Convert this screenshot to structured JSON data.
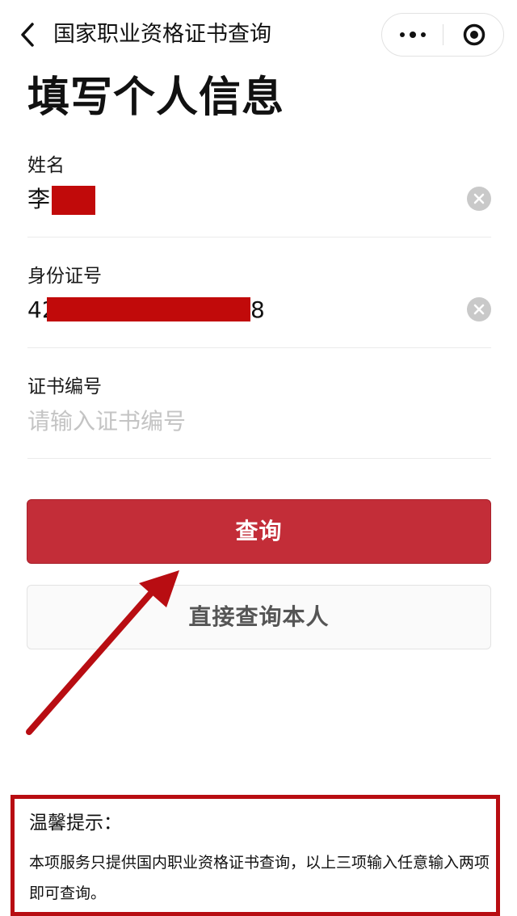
{
  "nav": {
    "title": "国家职业资格证书查询",
    "back_icon": "chevron-left-icon",
    "more_icon": "more-dots-icon",
    "close_icon": "target-circle-icon"
  },
  "page": {
    "heading": "填写个人信息"
  },
  "form": {
    "name": {
      "label": "姓名",
      "value_visible": "李"
    },
    "id_number": {
      "label": "身份证号",
      "value_prefix": "42",
      "value_suffix": "8"
    },
    "cert_number": {
      "label": "证书编号",
      "placeholder": "请输入证书编号",
      "value": ""
    }
  },
  "buttons": {
    "query": "查询",
    "query_self": "直接查询本人"
  },
  "tip": {
    "title": "温馨提示：",
    "body": "本项服务只提供国内职业资格证书查询，以上三项输入任意输入两项即可查询。"
  },
  "colors": {
    "primary": "#c32d38",
    "annotation_red": "#b80d12",
    "redaction": "#c10a0a",
    "placeholder": "#c4c4c4"
  }
}
